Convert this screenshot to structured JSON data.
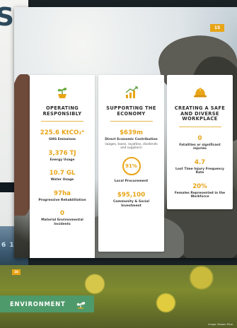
{
  "back_page": {
    "letter": "S",
    "strip_number": "6 1"
  },
  "main_page": {
    "page_badge": "15",
    "columns": [
      {
        "icon": "plant-icon",
        "title": "OPERATING RESPONSIBLY",
        "stats": [
          {
            "value": "225.6 KtCO₂ᵉ",
            "label": "GHG Emissions"
          },
          {
            "value": "3,376 TJ",
            "label": "Energy Usage"
          },
          {
            "value": "10.7 GL",
            "label": "Water Usage"
          },
          {
            "value": "97ha",
            "label": "Progressive Rehabilitation"
          },
          {
            "value": "0",
            "label": "Material Environmental Incidents"
          }
        ]
      },
      {
        "icon": "bar-chart-icon",
        "title": "SUPPORTING THE ECONOMY",
        "stats": [
          {
            "value": "$639m",
            "label": "Direct Economic Contribution",
            "note": "(wages, taxes, royalties, dividends and suppliers)"
          },
          {
            "value": "91%",
            "label": "Local Procurement",
            "display": "circle"
          },
          {
            "value": "$95,100",
            "label": "Community & Social Investment"
          }
        ]
      },
      {
        "icon": "hard-hat-icon",
        "title": "CREATING A SAFE AND DIVERSE WORKPLACE",
        "stats": [
          {
            "value": "0",
            "label": "Fatalities or significant injuries"
          },
          {
            "value": "4.7",
            "label": "Lost Time Injury Frequency Rate"
          },
          {
            "value": "20%",
            "label": "Females Represented in the Workforce"
          }
        ]
      }
    ]
  },
  "bottom_page": {
    "page_badge": "16",
    "section_label": "ENVIRONMENT",
    "section_icon": "leaf-icon",
    "credit": "Image: Boston Mine"
  },
  "colors": {
    "accent": "#e8a417",
    "environment": "#4f9a6a"
  }
}
